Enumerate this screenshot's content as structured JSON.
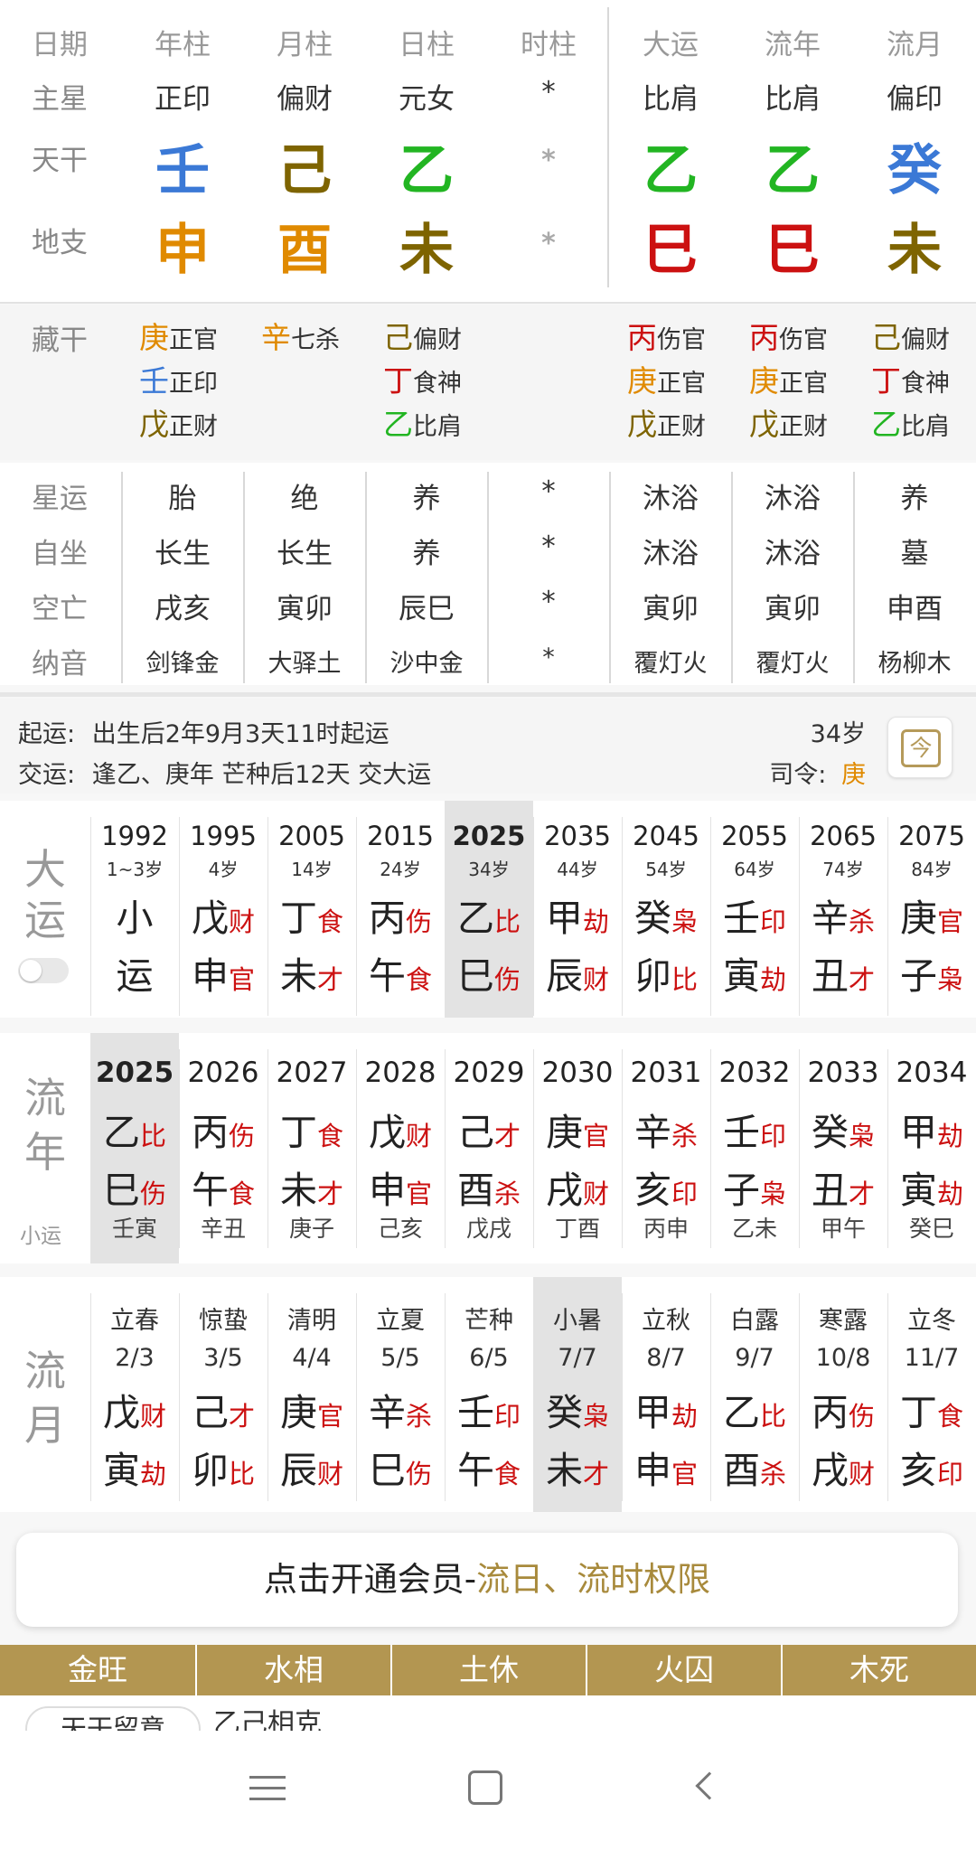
{
  "colors": {
    "wood": "#22b522",
    "metal": "#e08a00",
    "earth": "#7e6400",
    "water": "#3b79d6",
    "fire": "#cc1111",
    "gold": "#a88a3c",
    "label": "#888888"
  },
  "pillars": {
    "headers": [
      "日期",
      "年柱",
      "月柱",
      "日柱",
      "时柱",
      "大运",
      "流年",
      "流月"
    ],
    "row_labels": [
      "主星",
      "天干",
      "地支"
    ],
    "zhuxing": [
      "正印",
      "偏财",
      "元女",
      "*",
      "比肩",
      "比肩",
      "偏印"
    ],
    "tiangan": [
      {
        "c": "壬",
        "el": "water"
      },
      {
        "c": "己",
        "el": "earth"
      },
      {
        "c": "乙",
        "el": "wood"
      },
      {
        "c": "*",
        "el": "none"
      },
      {
        "c": "乙",
        "el": "wood"
      },
      {
        "c": "乙",
        "el": "wood"
      },
      {
        "c": "癸",
        "el": "water"
      }
    ],
    "dizhi": [
      {
        "c": "申",
        "el": "metal"
      },
      {
        "c": "酉",
        "el": "metal"
      },
      {
        "c": "未",
        "el": "earth"
      },
      {
        "c": "*",
        "el": "none"
      },
      {
        "c": "巳",
        "el": "fire"
      },
      {
        "c": "巳",
        "el": "fire"
      },
      {
        "c": "未",
        "el": "earth"
      }
    ]
  },
  "hidden": {
    "label": "藏干",
    "cols": [
      [
        {
          "s": "庚",
          "el": "metal",
          "g": "正官"
        },
        {
          "s": "壬",
          "el": "water",
          "g": "正印"
        },
        {
          "s": "戊",
          "el": "earth",
          "g": "正财"
        }
      ],
      [
        {
          "s": "辛",
          "el": "metal",
          "g": "七杀"
        }
      ],
      [
        {
          "s": "己",
          "el": "earth",
          "g": "偏财"
        },
        {
          "s": "丁",
          "el": "fire",
          "g": "食神"
        },
        {
          "s": "乙",
          "el": "wood",
          "g": "比肩"
        }
      ],
      [],
      [
        {
          "s": "丙",
          "el": "fire",
          "g": "伤官"
        },
        {
          "s": "庚",
          "el": "metal",
          "g": "正官"
        },
        {
          "s": "戊",
          "el": "earth",
          "g": "正财"
        }
      ],
      [
        {
          "s": "丙",
          "el": "fire",
          "g": "伤官"
        },
        {
          "s": "庚",
          "el": "metal",
          "g": "正官"
        },
        {
          "s": "戊",
          "el": "earth",
          "g": "正财"
        }
      ],
      [
        {
          "s": "己",
          "el": "earth",
          "g": "偏财"
        },
        {
          "s": "丁",
          "el": "fire",
          "g": "食神"
        },
        {
          "s": "乙",
          "el": "wood",
          "g": "比肩"
        }
      ]
    ]
  },
  "stars": {
    "rows": [
      {
        "label": "星运",
        "vals": [
          "胎",
          "绝",
          "养",
          "*",
          "沐浴",
          "沐浴",
          "养"
        ]
      },
      {
        "label": "自坐",
        "vals": [
          "长生",
          "长生",
          "养",
          "*",
          "沐浴",
          "沐浴",
          "墓"
        ]
      },
      {
        "label": "空亡",
        "vals": [
          "戌亥",
          "寅卯",
          "辰巳",
          "*",
          "寅卯",
          "寅卯",
          "申酉"
        ]
      },
      {
        "label": "纳音",
        "vals": [
          "剑锋金",
          "大驿土",
          "沙中金",
          "*",
          "覆灯火",
          "覆灯火",
          "杨柳木"
        ]
      }
    ]
  },
  "info": {
    "qiyun_label": "起运:",
    "qiyun_text": "出生后2年9月3天11时起运",
    "jiaoyun_label": "交运:",
    "jiaoyun_text": "逢乙、庚年 芒种后12天 交大运",
    "age": "34岁",
    "siling_label": "司令:",
    "siling_value": "庚",
    "today_icon": "今"
  },
  "dayun": {
    "label": [
      "大",
      "运"
    ],
    "items": [
      {
        "year": "1992",
        "age": "1~3岁",
        "s": "小",
        "st": "",
        "b": "运",
        "bt": ""
      },
      {
        "year": "1995",
        "age": "4岁",
        "s": "戊",
        "st": "财",
        "b": "申",
        "bt": "官"
      },
      {
        "year": "2005",
        "age": "14岁",
        "s": "丁",
        "st": "食",
        "b": "未",
        "bt": "才"
      },
      {
        "year": "2015",
        "age": "24岁",
        "s": "丙",
        "st": "伤",
        "b": "午",
        "bt": "食"
      },
      {
        "year": "2025",
        "age": "34岁",
        "s": "乙",
        "st": "比",
        "b": "巳",
        "bt": "伤"
      },
      {
        "year": "2035",
        "age": "44岁",
        "s": "甲",
        "st": "劫",
        "b": "辰",
        "bt": "财"
      },
      {
        "year": "2045",
        "age": "54岁",
        "s": "癸",
        "st": "枭",
        "b": "卯",
        "bt": "比"
      },
      {
        "year": "2055",
        "age": "64岁",
        "s": "壬",
        "st": "印",
        "b": "寅",
        "bt": "劫"
      },
      {
        "year": "2065",
        "age": "74岁",
        "s": "辛",
        "st": "杀",
        "b": "丑",
        "bt": "才"
      },
      {
        "year": "2075",
        "age": "84岁",
        "s": "庚",
        "st": "官",
        "b": "子",
        "bt": "枭"
      }
    ]
  },
  "liunian": {
    "label": [
      "流",
      "年"
    ],
    "sub": "小运",
    "items": [
      {
        "year": "2025",
        "s": "乙",
        "st": "比",
        "b": "巳",
        "bt": "伤",
        "x": "壬寅"
      },
      {
        "year": "2026",
        "s": "丙",
        "st": "伤",
        "b": "午",
        "bt": "食",
        "x": "辛丑"
      },
      {
        "year": "2027",
        "s": "丁",
        "st": "食",
        "b": "未",
        "bt": "才",
        "x": "庚子"
      },
      {
        "year": "2028",
        "s": "戊",
        "st": "财",
        "b": "申",
        "bt": "官",
        "x": "己亥"
      },
      {
        "year": "2029",
        "s": "己",
        "st": "才",
        "b": "酉",
        "bt": "杀",
        "x": "戊戌"
      },
      {
        "year": "2030",
        "s": "庚",
        "st": "官",
        "b": "戌",
        "bt": "财",
        "x": "丁酉"
      },
      {
        "year": "2031",
        "s": "辛",
        "st": "杀",
        "b": "亥",
        "bt": "印",
        "x": "丙申"
      },
      {
        "year": "2032",
        "s": "壬",
        "st": "印",
        "b": "子",
        "bt": "枭",
        "x": "乙未"
      },
      {
        "year": "2033",
        "s": "癸",
        "st": "枭",
        "b": "丑",
        "bt": "才",
        "x": "甲午"
      },
      {
        "year": "2034",
        "s": "甲",
        "st": "劫",
        "b": "寅",
        "bt": "劫",
        "x": "癸巳"
      }
    ]
  },
  "liuyue": {
    "label": [
      "流",
      "月"
    ],
    "items": [
      {
        "term": "立春",
        "date": "2/3",
        "s": "戊",
        "st": "财",
        "b": "寅",
        "bt": "劫"
      },
      {
        "term": "惊蛰",
        "date": "3/5",
        "s": "己",
        "st": "才",
        "b": "卯",
        "bt": "比"
      },
      {
        "term": "清明",
        "date": "4/4",
        "s": "庚",
        "st": "官",
        "b": "辰",
        "bt": "财"
      },
      {
        "term": "立夏",
        "date": "5/5",
        "s": "辛",
        "st": "杀",
        "b": "巳",
        "bt": "伤"
      },
      {
        "term": "芒种",
        "date": "6/5",
        "s": "壬",
        "st": "印",
        "b": "午",
        "bt": "食"
      },
      {
        "term": "小暑",
        "date": "7/7",
        "s": "癸",
        "st": "枭",
        "b": "未",
        "bt": "才"
      },
      {
        "term": "立秋",
        "date": "8/7",
        "s": "甲",
        "st": "劫",
        "b": "申",
        "bt": "官"
      },
      {
        "term": "白露",
        "date": "9/7",
        "s": "乙",
        "st": "比",
        "b": "酉",
        "bt": "杀"
      },
      {
        "term": "寒露",
        "date": "10/8",
        "s": "丙",
        "st": "伤",
        "b": "戌",
        "bt": "财"
      },
      {
        "term": "立冬",
        "date": "11/7",
        "s": "丁",
        "st": "食",
        "b": "亥",
        "bt": "印"
      }
    ]
  },
  "member_banner": {
    "prefix": "点击开通会员-",
    "highlight": "流日、流时权限"
  },
  "wuxing": [
    "金旺",
    "水相",
    "土休",
    "火囚",
    "木死"
  ],
  "partial": {
    "tag": "天干留意",
    "text": "乙己相克"
  },
  "nav": {
    "menu_icon": "menu-icon",
    "home_icon": "home-icon",
    "back_icon": "back-icon"
  }
}
